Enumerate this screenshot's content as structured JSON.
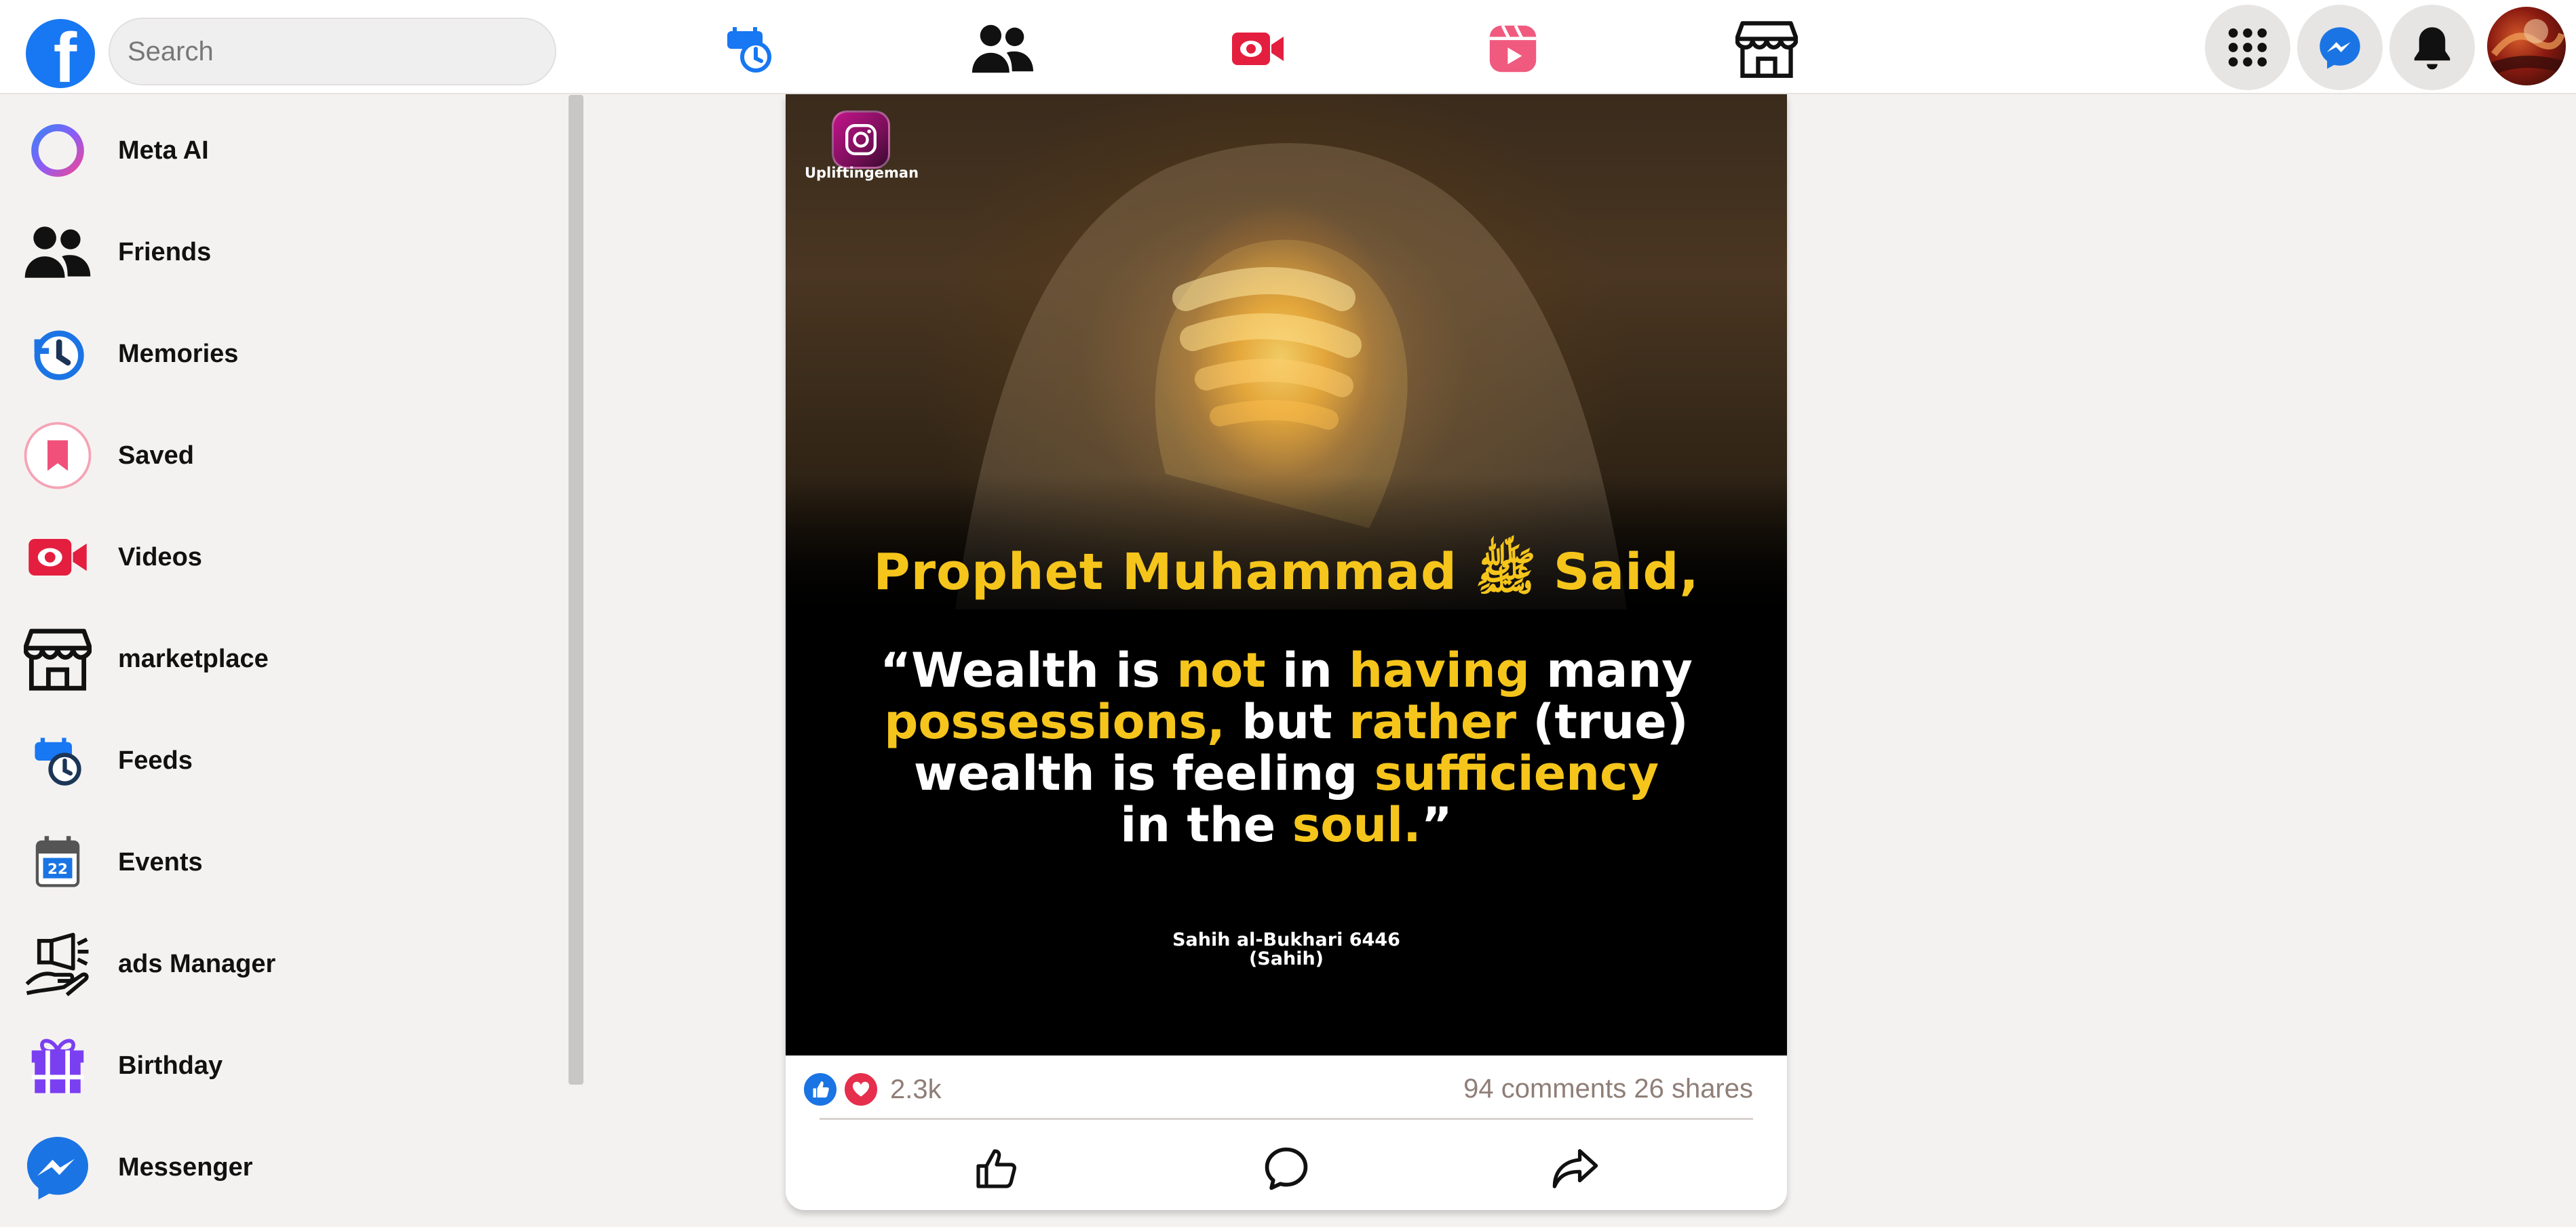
{
  "header": {
    "logo_letter": "f",
    "search_placeholder": "Search",
    "nav_icons": [
      "feeds-icon",
      "friends-icon",
      "video-icon",
      "reels-icon",
      "marketplace-icon"
    ],
    "right_buttons": [
      "menu-grid-icon",
      "messenger-icon",
      "bell-icon"
    ]
  },
  "sidebar": {
    "items": [
      {
        "label": "Meta AI",
        "icon": "meta-ai-icon"
      },
      {
        "label": "Friends",
        "icon": "friends-icon"
      },
      {
        "label": "Memories",
        "icon": "memories-icon"
      },
      {
        "label": "Saved",
        "icon": "bookmark-icon"
      },
      {
        "label": "Videos",
        "icon": "video-icon"
      },
      {
        "label": "marketplace",
        "icon": "marketplace-icon"
      },
      {
        "label": "Feeds",
        "icon": "feeds-icon"
      },
      {
        "label": "Events",
        "icon": "calendar-icon"
      },
      {
        "label": "ads Manager",
        "icon": "megaphone-icon"
      },
      {
        "label": "Birthday",
        "icon": "gift-icon"
      },
      {
        "label": "Messenger",
        "icon": "messenger-icon"
      }
    ],
    "events_day": "22"
  },
  "post": {
    "ig_handle": "Upliftingeman",
    "heading": "Prophet Muhammad ﷺ Said,",
    "quote": {
      "w1": "“Wealth is ",
      "w2": "not",
      "w3": " in ",
      "w4": "having",
      "w5": " many",
      "w6": "possessions,",
      "w7": " but ",
      "w8": "rather",
      "w9": " (true)",
      "w10": "wealth is feeling ",
      "w11": "sufficiency",
      "w12": "in the ",
      "w13": "soul.",
      "w14": "”"
    },
    "source_line1": "Sahih al-Bukhari 6446",
    "source_line2": "(Sahih)",
    "reaction_count": "2.3k",
    "stats": "94 comments 26 shares",
    "actions": [
      "like-icon",
      "comment-icon",
      "share-icon"
    ]
  },
  "colors": {
    "brand": "#1877f2",
    "quote_highlight": "#f5c51b",
    "love": "#e62e4d",
    "muted_text": "#8f7e77"
  }
}
